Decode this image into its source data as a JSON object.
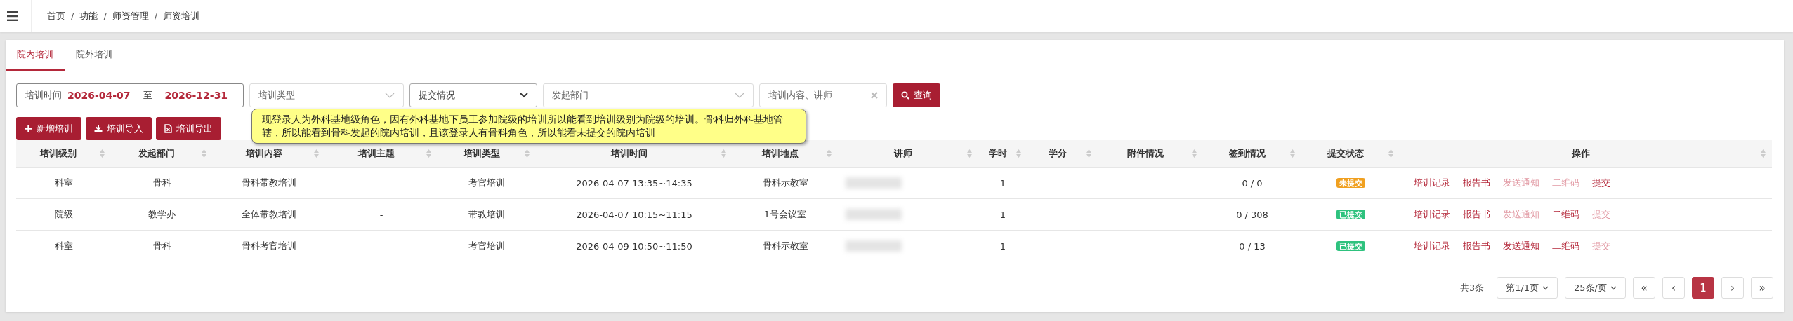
{
  "breadcrumb": [
    {
      "kind": "link",
      "text": "首页"
    },
    {
      "kind": "separator",
      "text": "/"
    },
    {
      "kind": "link",
      "text": "功能"
    },
    {
      "kind": "separator",
      "text": "/"
    },
    {
      "kind": "link",
      "text": "师资管理"
    },
    {
      "kind": "separator",
      "text": "/"
    },
    {
      "kind": "current",
      "text": "师资培训"
    }
  ],
  "tabs": [
    {
      "label": "院内培训",
      "selected": true
    },
    {
      "label": "院外培训",
      "selected": false
    }
  ],
  "filters": {
    "date_label": "培训时间",
    "date_from": "2026-04-07",
    "date_sep": "至",
    "date_to": "2026-12-31",
    "type_placeholder": "培训类型",
    "submit_placeholder": "提交情况",
    "dept_placeholder": "发起部门",
    "keyword_placeholder": "培训内容、讲师",
    "search_button": "查询"
  },
  "actions": [
    "新增培训",
    "培训导入",
    "培训导出"
  ],
  "tooltip": "现登录人为外科基地级角色，因有外科基地下员工参加院级的培训所以能看到培训级别为院级的培训。骨科归外科基地管辖，所以能看到骨科发起的院内培训，且该登录人有骨科角色，所以能看未提交的院内培训",
  "table": {
    "columns": [
      "培训级别",
      "发起部门",
      "培训内容",
      "培训主题",
      "培训类型",
      "培训时间",
      "培训地点",
      "讲师",
      "学时",
      "学分",
      "附件情况",
      "签到情况",
      "提交状态",
      "操作"
    ],
    "rows": [
      {
        "level": "科室",
        "dept": "骨科",
        "content": "骨科带教培训",
        "topic": "-",
        "type": "考官培训",
        "time": "2026-04-07  13:35~14:35",
        "place": "骨科示教室",
        "hours": "1",
        "credit": "",
        "attach": "",
        "signin": "0 / 0",
        "status": {
          "label": "未提交",
          "kind": "pending"
        },
        "ops": [
          {
            "label": "培训记录",
            "disabled": false
          },
          {
            "label": "报告书",
            "disabled": false
          },
          {
            "label": "发送通知",
            "disabled": true
          },
          {
            "label": "二维码",
            "disabled": true
          },
          {
            "label": "提交",
            "disabled": false
          }
        ]
      },
      {
        "level": "院级",
        "dept": "教学办",
        "content": "全体带教培训",
        "topic": "-",
        "type": "带教培训",
        "time": "2026-04-07  10:15~11:15",
        "place": "1号会议室",
        "hours": "1",
        "credit": "",
        "attach": "",
        "signin": "0 / 308",
        "status": {
          "label": "已提交",
          "kind": "done"
        },
        "ops": [
          {
            "label": "培训记录",
            "disabled": false
          },
          {
            "label": "报告书",
            "disabled": false
          },
          {
            "label": "发送通知",
            "disabled": true
          },
          {
            "label": "二维码",
            "disabled": false
          },
          {
            "label": "提交",
            "disabled": true
          }
        ]
      },
      {
        "level": "科室",
        "dept": "骨科",
        "content": "骨科考官培训",
        "topic": "-",
        "type": "考官培训",
        "time": "2026-04-09  10:50~11:50",
        "place": "骨科示教室",
        "hours": "1",
        "credit": "",
        "attach": "",
        "signin": "0 / 13",
        "status": {
          "label": "已提交",
          "kind": "done"
        },
        "ops": [
          {
            "label": "培训记录",
            "disabled": false
          },
          {
            "label": "报告书",
            "disabled": false
          },
          {
            "label": "发送通知",
            "disabled": false
          },
          {
            "label": "二维码",
            "disabled": false
          },
          {
            "label": "提交",
            "disabled": true
          }
        ]
      }
    ]
  },
  "pagination": {
    "total": "共3条",
    "page_select": "第1/1页",
    "size_select": "25条/页",
    "first": "«",
    "prev": "‹",
    "pages": [
      {
        "label": "1",
        "selected": true
      }
    ],
    "next": "›",
    "last": "»"
  }
}
